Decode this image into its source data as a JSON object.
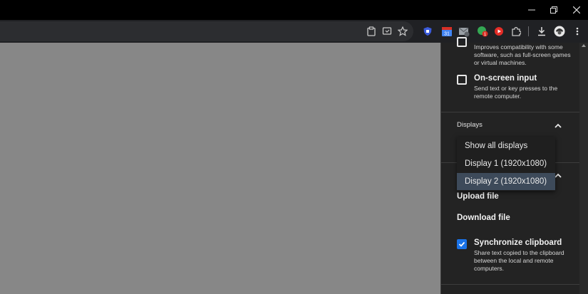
{
  "window": {
    "minimize_label": "Minimize",
    "restore_label": "Restore",
    "close_label": "Close"
  },
  "toolbar": {
    "icons": [
      "clipboard-icon",
      "cast-icon",
      "bookmark-star-icon",
      "shield-extension-icon",
      "calendar-extension-icon",
      "mail-extension-icon",
      "grammar-extension-icon",
      "youtube-extension-icon",
      "puzzle-extensions-icon",
      "download-icon",
      "avatar",
      "more-vert-icon"
    ],
    "calendar_badge": "31",
    "grammar_badge": "1"
  },
  "panel": {
    "relative_mouse": {
      "description": "Improves compatibility with some software, such as full-screen games or virtual machines."
    },
    "onscreen_input": {
      "title": "On-screen input",
      "description": "Send text or key presses to the remote computer."
    },
    "displays": {
      "label": "Displays",
      "options": [
        "Show all displays",
        "Display 1 (1920x1080)",
        "Display 2 (1920x1080)"
      ],
      "selected": "Display 2 (1920x1080)"
    },
    "files": {
      "upload": "Upload file",
      "download": "Download file"
    },
    "sync_clipboard": {
      "title": "Synchronize clipboard",
      "description": "Share text copied to the clipboard between the local and remote computers."
    }
  },
  "colors": {
    "accent": "#1a73e8",
    "panel_bg": "#232323",
    "remote_bg": "#878787",
    "selected_bg": "#3d4a5a"
  }
}
